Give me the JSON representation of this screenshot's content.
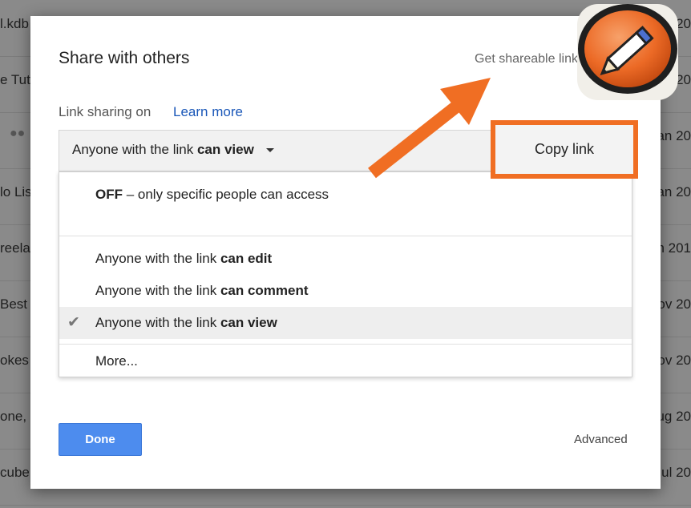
{
  "background_rows": [
    {
      "left": "l.kdb",
      "right": "Jun 20"
    },
    {
      "left": "e Tut",
      "right": "n 20"
    },
    {
      "left": "",
      "right": "an 20"
    },
    {
      "left": "lo Lis",
      "right": "an 20"
    },
    {
      "left": "reela",
      "right": "n 201"
    },
    {
      "left": "Best",
      "right": "ov 20"
    },
    {
      "left": "okes",
      "right": "ov 20"
    },
    {
      "left": "one,",
      "right": "ug 20"
    },
    {
      "left": "cube",
      "right": "ul 20"
    }
  ],
  "background_people_icon": "people-icon",
  "dialog": {
    "title": "Share with others",
    "get_shareable_link": "Get shareable link",
    "link_icon": "link-icon",
    "sharing_status": "Link sharing on",
    "learn_more": "Learn more",
    "select": {
      "prefix": "Anyone with the link",
      "bold": "can view"
    },
    "copy_link": "Copy link",
    "menu": {
      "off_bold": "OFF",
      "off_rest": " – only specific people can access",
      "items": [
        {
          "prefix": "Anyone with the link",
          "bold": "can edit"
        },
        {
          "prefix": "Anyone with the link",
          "bold": "can comment"
        },
        {
          "prefix": "Anyone with the link",
          "bold": "can view"
        }
      ],
      "selected_index": 2,
      "check_icon": "check-icon",
      "more": "More..."
    },
    "done": "Done",
    "advanced": "Advanced"
  },
  "annotation": {
    "arrow_color": "#f06e23",
    "highlight_color": "#f06e23",
    "badge_icon": "pencil-logo-icon"
  }
}
